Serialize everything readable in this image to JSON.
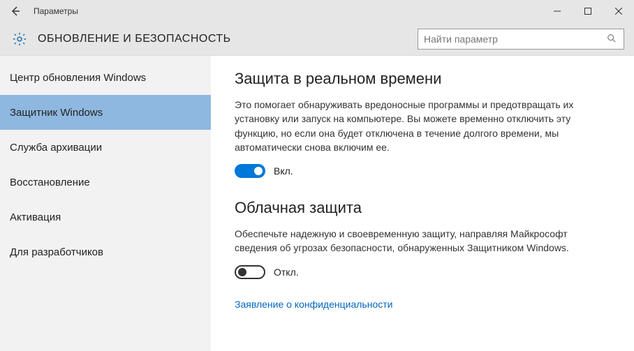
{
  "window": {
    "title": "Параметры"
  },
  "header": {
    "title": "ОБНОВЛЕНИЕ И БЕЗОПАСНОСТЬ",
    "search_placeholder": "Найти параметр"
  },
  "sidebar": {
    "items": [
      {
        "label": "Центр обновления Windows",
        "selected": false
      },
      {
        "label": "Защитник Windows",
        "selected": true
      },
      {
        "label": "Служба архивации",
        "selected": false
      },
      {
        "label": "Восстановление",
        "selected": false
      },
      {
        "label": "Активация",
        "selected": false
      },
      {
        "label": "Для разработчиков",
        "selected": false
      }
    ]
  },
  "content": {
    "section1": {
      "heading": "Защита в реальном времени",
      "desc": "Это помогает обнаруживать вредоносные программы и предотвращать их установку или запуск на компьютере. Вы можете временно отключить эту функцию, но если она будет отключена в течение долгого времени, мы автоматически снова включим ее.",
      "toggle_state": "on",
      "toggle_label": "Вкл."
    },
    "section2": {
      "heading": "Облачная защита",
      "desc": "Обеспечьте надежную и своевременную защиту, направляя Майкрософт сведения об угрозах безопасности, обнаруженных Защитником Windows.",
      "toggle_state": "off",
      "toggle_label": "Откл."
    },
    "privacy_link": "Заявление о конфиденциальности"
  }
}
